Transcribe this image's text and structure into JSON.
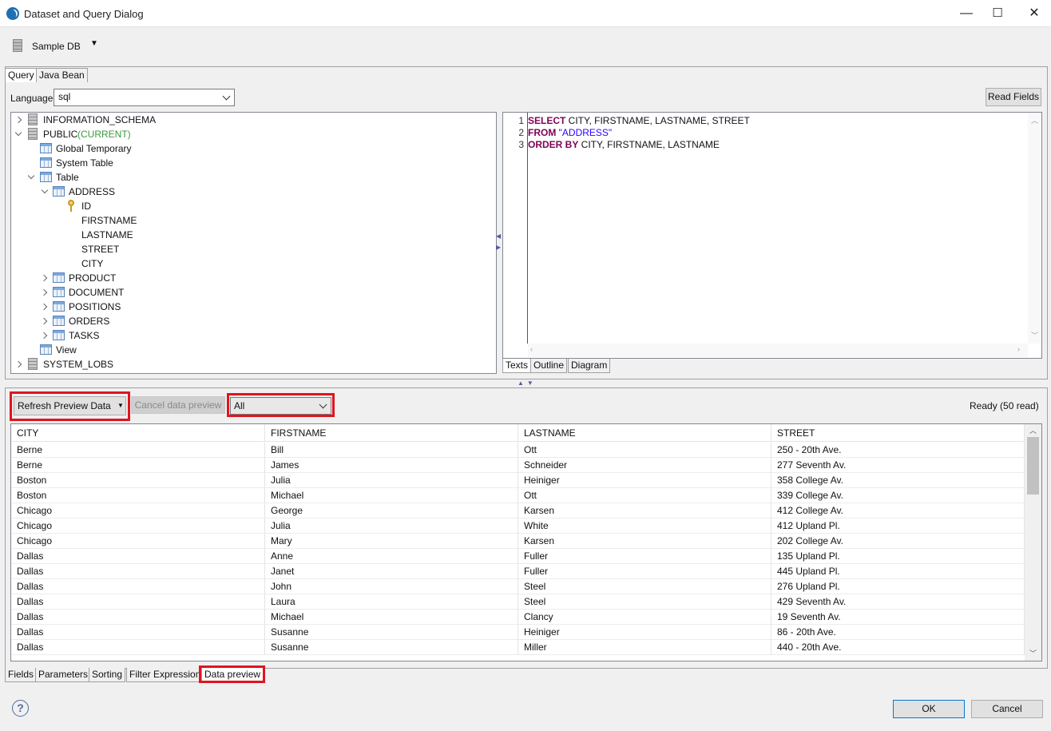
{
  "window": {
    "title": "Dataset and Query Dialog",
    "minimize": "—",
    "maximize": "☐",
    "close": "✕"
  },
  "datasource": {
    "label": "Sample DB"
  },
  "upper_tabs": [
    "Query",
    "Java Bean"
  ],
  "language": {
    "label": "Language",
    "value": "sql"
  },
  "read_fields_label": "Read Fields",
  "tree": {
    "schema_info": "INFORMATION_SCHEMA",
    "schema_public": "PUBLIC",
    "schema_public_current": "(CURRENT)",
    "global_temporary": "Global Temporary",
    "system_table": "System Table",
    "table": "Table",
    "address": "ADDRESS",
    "fields": [
      "ID",
      "FIRSTNAME",
      "LASTNAME",
      "STREET",
      "CITY"
    ],
    "other_tables": [
      "PRODUCT",
      "DOCUMENT",
      "POSITIONS",
      "ORDERS",
      "TASKS"
    ],
    "view": "View",
    "system_lobs": "SYSTEM_LOBS"
  },
  "editor": {
    "line_numbers": [
      "1",
      "2",
      "3"
    ],
    "line1_kw": "SELECT",
    "line1_rest": " CITY, FIRSTNAME, LASTNAME, STREET",
    "line2_kw": "FROM",
    "line2_str": " \"ADDRESS\"",
    "line3_kw": "ORDER BY",
    "line3_rest": " CITY, FIRSTNAME, LASTNAME"
  },
  "editor_tabs": [
    "Texts",
    "Outline",
    "Diagram"
  ],
  "preview": {
    "refresh_label": "Refresh Preview Data",
    "cancel_label": "Cancel data preview",
    "filter_value": "All",
    "status": "Ready (50 read)"
  },
  "grid": {
    "columns": [
      "CITY",
      "FIRSTNAME",
      "LASTNAME",
      "STREET"
    ],
    "rows": [
      [
        "Berne",
        "Bill",
        "Ott",
        "250 - 20th Ave."
      ],
      [
        "Berne",
        "James",
        "Schneider",
        "277 Seventh Av."
      ],
      [
        "Boston",
        "Julia",
        "Heiniger",
        "358 College Av."
      ],
      [
        "Boston",
        "Michael",
        "Ott",
        "339 College Av."
      ],
      [
        "Chicago",
        "George",
        "Karsen",
        "412 College Av."
      ],
      [
        "Chicago",
        "Julia",
        "White",
        "412 Upland Pl."
      ],
      [
        "Chicago",
        "Mary",
        "Karsen",
        "202 College Av."
      ],
      [
        "Dallas",
        "Anne",
        "Fuller",
        "135 Upland Pl."
      ],
      [
        "Dallas",
        "Janet",
        "Fuller",
        "445 Upland Pl."
      ],
      [
        "Dallas",
        "John",
        "Steel",
        "276 Upland Pl."
      ],
      [
        "Dallas",
        "Laura",
        "Steel",
        "429 Seventh Av."
      ],
      [
        "Dallas",
        "Michael",
        "Clancy",
        "19 Seventh Av."
      ],
      [
        "Dallas",
        "Susanne",
        "Heiniger",
        "86 - 20th Ave."
      ],
      [
        "Dallas",
        "Susanne",
        "Miller",
        "440 - 20th Ave."
      ]
    ]
  },
  "bottom_tabs": [
    "Fields",
    "Parameters",
    "Sorting",
    "Filter Expression",
    "Data preview"
  ],
  "footer": {
    "ok": "OK",
    "cancel": "Cancel",
    "help": "?"
  },
  "colors": {
    "highlight_box": "#e0141e",
    "keyword": "#7f0055",
    "string": "#2a00ff",
    "current": "#3a9a3a"
  }
}
